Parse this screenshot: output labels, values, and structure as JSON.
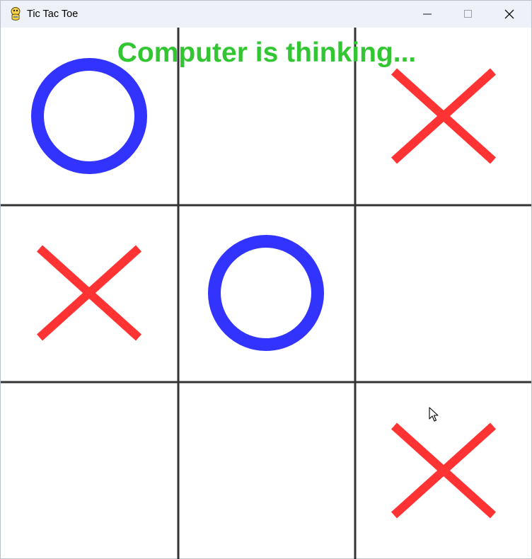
{
  "window": {
    "title": "Tic Tac Toe",
    "icon": "pygame-snake-icon",
    "controls": [
      "minimize-icon",
      "maximize-icon",
      "close-icon"
    ]
  },
  "game": {
    "status_text": "Computer is thinking...",
    "status_color": "#33c633",
    "x_color": "#ff3333",
    "o_color": "#3333ff",
    "grid_color": "#333333",
    "board": [
      [
        "O",
        "",
        "X"
      ],
      [
        "X",
        "O",
        ""
      ],
      [
        "",
        "",
        "X"
      ]
    ]
  }
}
